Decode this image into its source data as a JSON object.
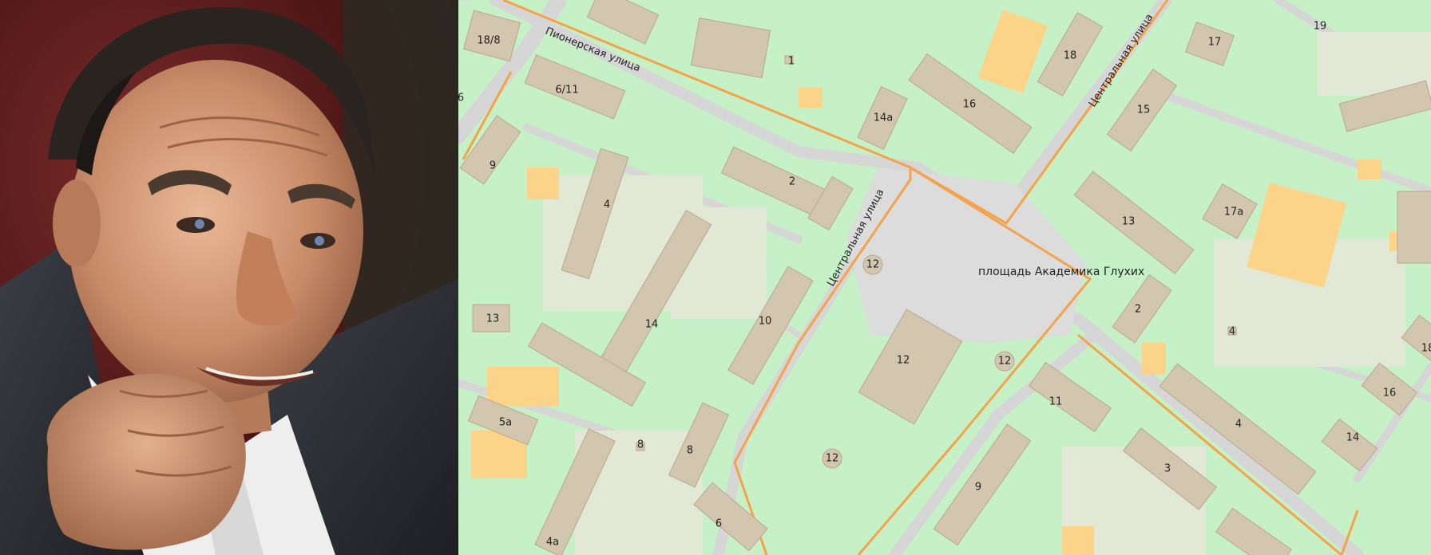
{
  "photo": {
    "subject": "portrait-photo"
  },
  "map": {
    "streets": {
      "pionerskaya": "Пионерская улица",
      "centralnaya_left": "Центральная улица",
      "centralnaya_right": "Центральная улица"
    },
    "square": "площадь Академика Глухих",
    "buildings": [
      "18/8",
      "6/11",
      "9",
      "4",
      "13",
      "14",
      "5а",
      "4а",
      "8",
      "8",
      "6",
      "2",
      "1",
      "10",
      "12",
      "12",
      "12",
      "12",
      "11",
      "9",
      "14а",
      "16",
      "18",
      "15",
      "17",
      "19",
      "13",
      "17а",
      "2",
      "4",
      "3",
      "4",
      "16",
      "14",
      "18",
      "6"
    ]
  }
}
